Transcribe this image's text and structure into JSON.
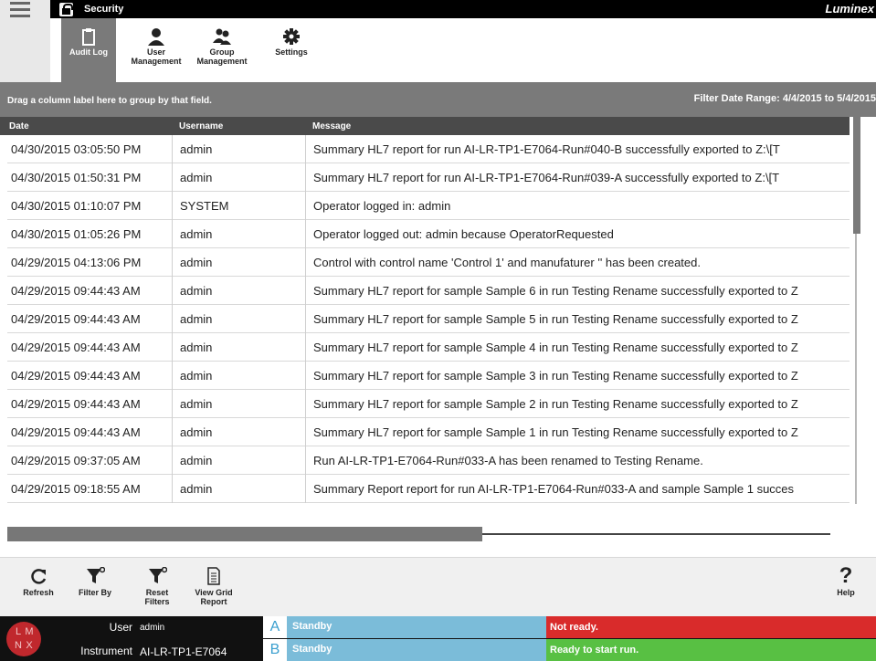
{
  "app": {
    "title": "Security",
    "brand": "Luminex"
  },
  "nav": {
    "items": [
      {
        "label_line1": "Audit Log",
        "label_line2": "",
        "icon": "clipboard-icon",
        "active": true
      },
      {
        "label_line1": "User",
        "label_line2": "Management",
        "icon": "user-icon",
        "active": false
      },
      {
        "label_line1": "Group",
        "label_line2": "Management",
        "icon": "group-icon",
        "active": false
      },
      {
        "label_line1": "Settings",
        "label_line2": "",
        "icon": "gear-icon",
        "active": false
      }
    ]
  },
  "groupbar": {
    "hint": "Drag a column label here to group by that field.",
    "filter_range": "Filter Date Range: 4/4/2015 to 5/4/2015"
  },
  "grid": {
    "columns": [
      "Date",
      "Username",
      "Message"
    ],
    "rows": [
      [
        "04/30/2015 03:05:50 PM",
        "admin",
        "Summary HL7 report for run AI-LR-TP1-E7064-Run#040-B successfully exported to Z:\\[T"
      ],
      [
        "04/30/2015 01:50:31 PM",
        "admin",
        "Summary HL7 report for run AI-LR-TP1-E7064-Run#039-A successfully exported to Z:\\[T"
      ],
      [
        "04/30/2015 01:10:07 PM",
        "SYSTEM",
        "Operator logged in: admin"
      ],
      [
        "04/30/2015 01:05:26 PM",
        "admin",
        "Operator logged out: admin because OperatorRequested"
      ],
      [
        "04/29/2015 04:13:06 PM",
        "admin",
        "Control with control name 'Control 1' and manufaturer '' has been created."
      ],
      [
        "04/29/2015 09:44:43 AM",
        "admin",
        "Summary HL7 report for sample Sample 6 in run Testing Rename successfully exported to Z"
      ],
      [
        "04/29/2015 09:44:43 AM",
        "admin",
        "Summary HL7 report for sample Sample 5 in run Testing Rename successfully exported to Z"
      ],
      [
        "04/29/2015 09:44:43 AM",
        "admin",
        "Summary HL7 report for sample Sample 4 in run Testing Rename successfully exported to Z"
      ],
      [
        "04/29/2015 09:44:43 AM",
        "admin",
        "Summary HL7 report for sample Sample 3 in run Testing Rename successfully exported to Z"
      ],
      [
        "04/29/2015 09:44:43 AM",
        "admin",
        "Summary HL7 report for sample Sample 2 in run Testing Rename successfully exported to Z"
      ],
      [
        "04/29/2015 09:44:43 AM",
        "admin",
        "Summary HL7 report for sample Sample 1 in run Testing Rename successfully exported to Z"
      ],
      [
        "04/29/2015 09:37:05 AM",
        "admin",
        "Run AI-LR-TP1-E7064-Run#033-A has been renamed to Testing Rename."
      ],
      [
        "04/29/2015 09:18:55 AM",
        "admin",
        "Summary Report report for run AI-LR-TP1-E7064-Run#033-A and sample Sample 1 succes"
      ]
    ]
  },
  "toolbar": {
    "refresh": "Refresh",
    "filter_by": "Filter By",
    "reset_filters_1": "Reset",
    "reset_filters_2": "Filters",
    "view_grid_report_1": "View Grid",
    "view_grid_report_2": "Report",
    "help": "Help"
  },
  "status": {
    "logo_letters": [
      "L",
      "M",
      "N",
      "X"
    ],
    "user_label": "User",
    "user_value": "admin",
    "instrument_label": "Instrument",
    "instrument_value": "AI-LR-TP1-E7064",
    "well_a_letter": "A",
    "well_a_status": "Standby",
    "well_b_letter": "B",
    "well_b_status": "Standby",
    "system_status": "Not ready.",
    "run_status": "Ready to start run."
  },
  "colors": {
    "nav_active": "#7a7a7a",
    "header_dark": "#4a4a4a",
    "standby": "#7bbcd9",
    "not_ready": "#d92b2b",
    "ready": "#58c043",
    "logo": "#c0282d"
  }
}
